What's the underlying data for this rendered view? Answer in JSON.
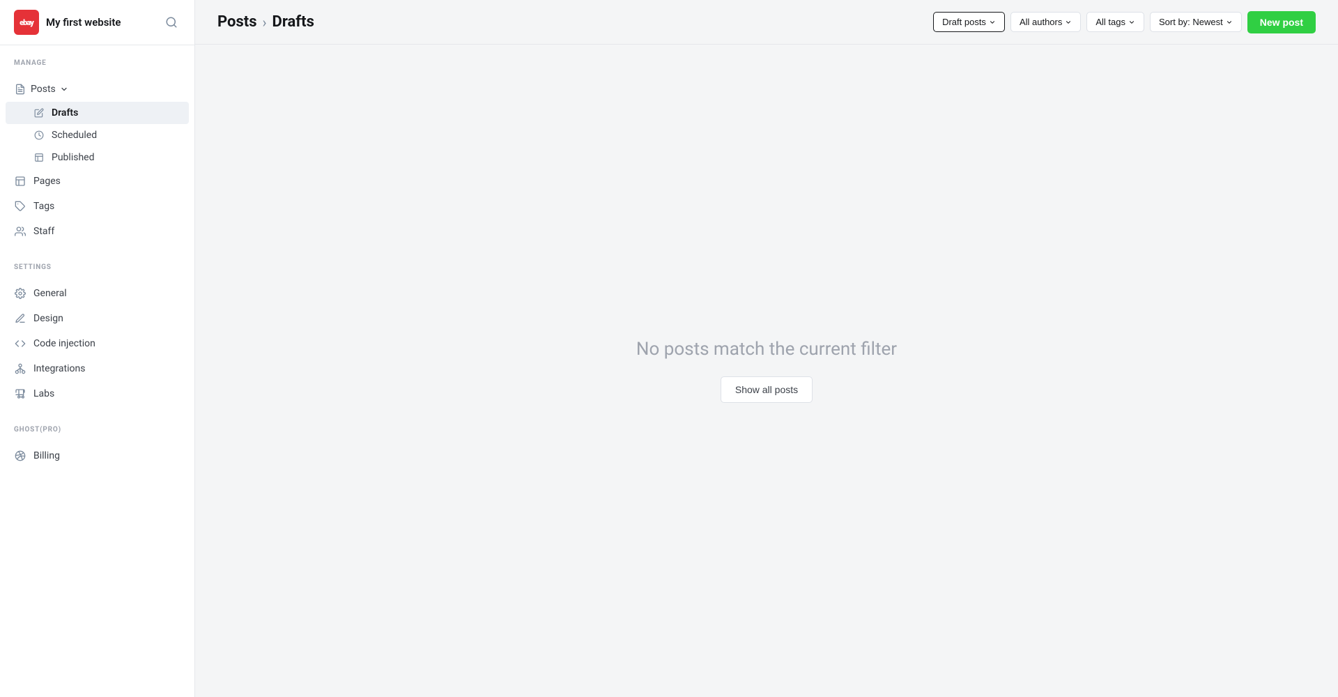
{
  "sidebar": {
    "brand": {
      "logo_text": "ebay",
      "site_name": "My first website"
    },
    "search_label": "Search",
    "manage_label": "MANAGE",
    "settings_label": "SETTINGS",
    "ghost_pro_label": "GHOST(PRO)",
    "nav": {
      "posts_label": "Posts",
      "drafts_label": "Drafts",
      "scheduled_label": "Scheduled",
      "published_label": "Published",
      "pages_label": "Pages",
      "tags_label": "Tags",
      "staff_label": "Staff"
    },
    "settings_nav": {
      "general_label": "General",
      "design_label": "Design",
      "code_injection_label": "Code injection",
      "integrations_label": "Integrations",
      "labs_label": "Labs"
    },
    "ghost_pro_nav": {
      "billing_label": "Billing"
    }
  },
  "header": {
    "breadcrumb_posts": "Posts",
    "breadcrumb_sep": "›",
    "breadcrumb_current": "Drafts",
    "filters": {
      "draft_posts": "Draft posts",
      "all_authors": "All authors",
      "all_tags": "All tags",
      "sort": "Sort by: Newest"
    },
    "new_post_label": "New post"
  },
  "main": {
    "empty_message": "No posts match the current filter",
    "show_all_label": "Show all posts"
  },
  "icons": {
    "chevron_down": "▾",
    "chevron_right": "›"
  }
}
